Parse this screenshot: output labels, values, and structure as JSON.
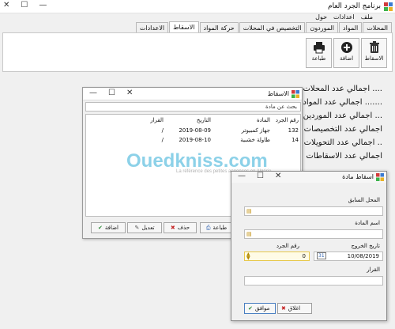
{
  "window": {
    "title": "برنامج الجرد العام",
    "minimize": "—",
    "maximize": "☐",
    "close": "✕"
  },
  "menu": [
    "ملف",
    "اعدادات",
    "حول"
  ],
  "tabs": [
    "المحلات",
    "المواد",
    "الموردون",
    "التخصيص في المحلات",
    "حركة المواد",
    "الاسقاط",
    "الاعدادات"
  ],
  "active_tab": "الاسقاط",
  "ribbon": {
    "buttons": [
      {
        "label": "الاسقاط",
        "icon": "trash-icon"
      },
      {
        "label": "اضافة",
        "icon": "add-icon"
      },
      {
        "label": "طباعة",
        "icon": "print-icon"
      }
    ]
  },
  "stats": [
    "اجمالي عدد المحلات ....",
    "اجمالي عدد المواد .......",
    "اجمالي عدد الموردين ...",
    "اجمالي عدد التخصيصات",
    "اجمالي عدد التحويلات ..",
    "اجمالي عدد الاسقاطات"
  ],
  "drop_window": {
    "title": "الاسقاط",
    "search_placeholder": "بحث عن مادة",
    "columns": [
      "رقم الجرد",
      "المادة",
      "التاريخ",
      "القرار"
    ],
    "rows": [
      [
        "132",
        "جهاز كمبيوتر",
        "2019-08-09",
        "/"
      ],
      [
        "14",
        "طاولة خشبية",
        "2019-08-10",
        "/"
      ]
    ],
    "buttons": [
      "طباعة",
      "حذف",
      "تعديل",
      "اضافة"
    ]
  },
  "drop_form": {
    "title": "اسقاط مادة",
    "previous_store_label": "المحل السابق",
    "item_name_label": "اسم المادة",
    "exit_date_label": "تاريخ الخروج",
    "exit_date_value": "10/08/2019",
    "inventory_no_label": "رقم الجرد",
    "inventory_no_value": "0",
    "decision_label": "القرار",
    "cancel_label": "اغلاق",
    "ok_label": "موافق",
    "calendar_day": "31"
  },
  "watermark": {
    "text": "Ouedkniss.com",
    "sub": "La référence des petites annonces en Algérie"
  }
}
